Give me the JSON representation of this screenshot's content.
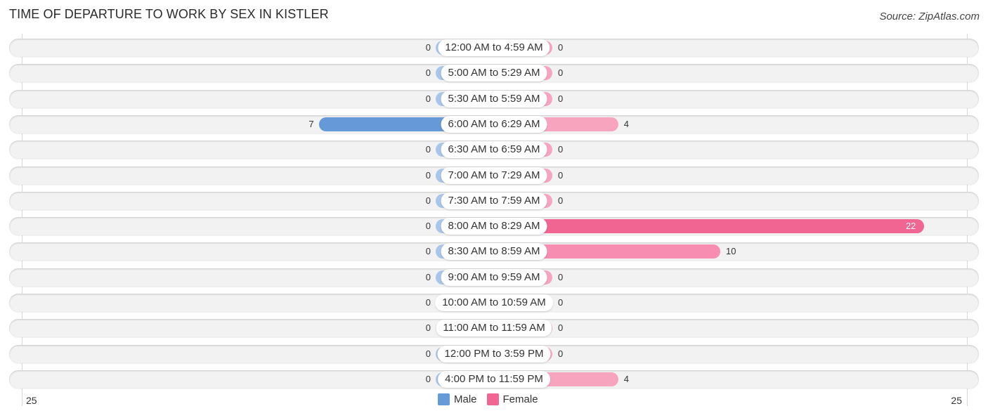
{
  "title": "TIME OF DEPARTURE TO WORK BY SEX IN KISTLER",
  "source": "Source: ZipAtlas.com",
  "colors": {
    "male_strong": "#6699d8",
    "male_light": "#a8c6ea",
    "female_strong": "#f06591",
    "female_mid": "#f78db0",
    "female_light": "#f7a5bf"
  },
  "chart_data": {
    "type": "bar",
    "orientation": "horizontal-diverging",
    "title": "TIME OF DEPARTURE TO WORK BY SEX IN KISTLER",
    "categories": [
      "12:00 AM to 4:59 AM",
      "5:00 AM to 5:29 AM",
      "5:30 AM to 5:59 AM",
      "6:00 AM to 6:29 AM",
      "6:30 AM to 6:59 AM",
      "7:00 AM to 7:29 AM",
      "7:30 AM to 7:59 AM",
      "8:00 AM to 8:29 AM",
      "8:30 AM to 8:59 AM",
      "9:00 AM to 9:59 AM",
      "10:00 AM to 10:59 AM",
      "11:00 AM to 11:59 AM",
      "12:00 PM to 3:59 PM",
      "4:00 PM to 11:59 PM"
    ],
    "series": [
      {
        "name": "Male",
        "values": [
          0,
          0,
          0,
          7,
          0,
          0,
          0,
          0,
          0,
          0,
          0,
          0,
          0,
          0
        ]
      },
      {
        "name": "Female",
        "values": [
          0,
          0,
          0,
          4,
          0,
          0,
          0,
          22,
          10,
          0,
          0,
          0,
          0,
          4
        ]
      }
    ],
    "axis": {
      "left_label": "25",
      "right_label": "25",
      "range": [
        -25,
        25
      ]
    },
    "legend": {
      "position": "bottom-center",
      "entries": [
        "Male",
        "Female"
      ]
    },
    "grid": false
  }
}
